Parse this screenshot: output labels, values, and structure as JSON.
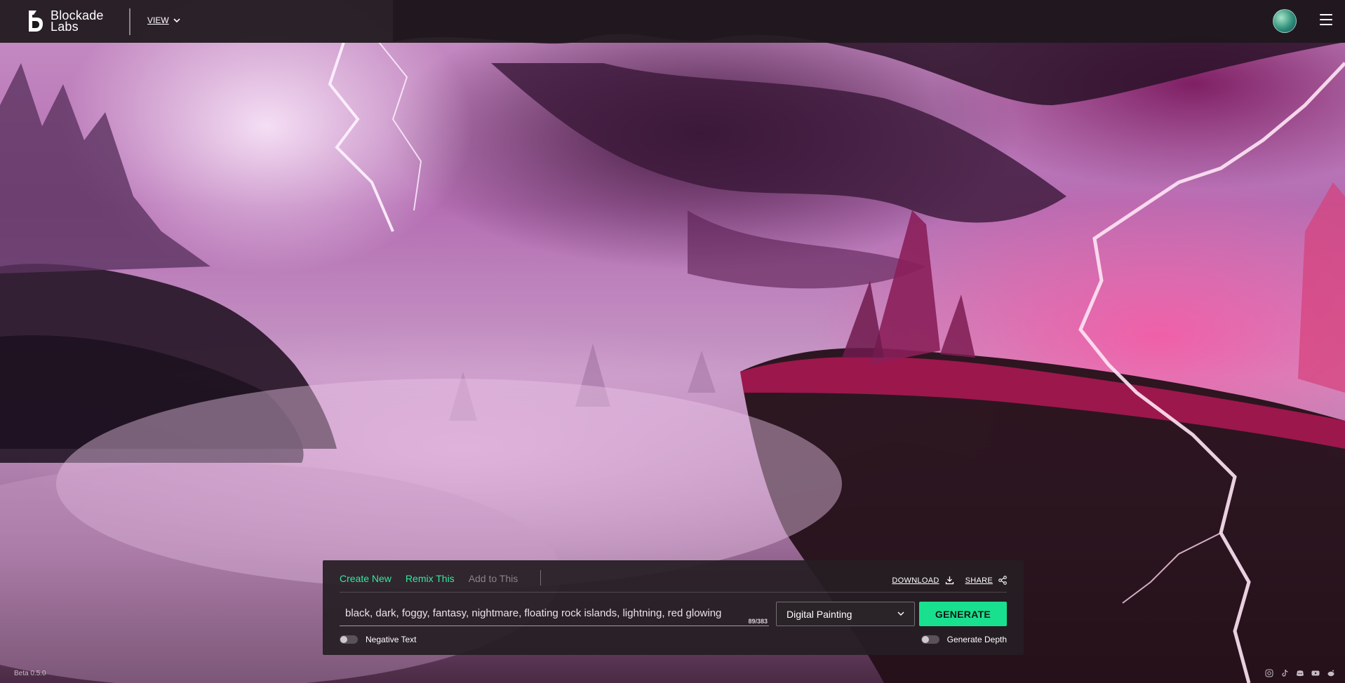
{
  "header": {
    "logo_line1": "Blockade",
    "logo_line2": "Labs",
    "view_label": "VIEW"
  },
  "panel": {
    "tabs": [
      {
        "label": "Create New",
        "state": "active"
      },
      {
        "label": "Remix This",
        "state": "active"
      },
      {
        "label": "Add to This",
        "state": "disabled"
      }
    ],
    "download_label": "DOWNLOAD",
    "share_label": "SHARE",
    "prompt_value": "black, dark, foggy, fantasy, nightmare, floating rock islands, lightning, red glowing",
    "char_count": "89/383",
    "style_selected": "Digital Painting",
    "generate_label": "GENERATE",
    "negative_text_label": "Negative Text",
    "generate_depth_label": "Generate Depth"
  },
  "footer": {
    "version": "Beta 0.5.0",
    "social_icons": [
      "instagram-icon",
      "tiktok-icon",
      "discord-icon",
      "youtube-icon",
      "reddit-icon"
    ]
  },
  "colors": {
    "accent": "#19e08f",
    "tab_active": "#34e89e",
    "panel_bg": "#261e24"
  }
}
